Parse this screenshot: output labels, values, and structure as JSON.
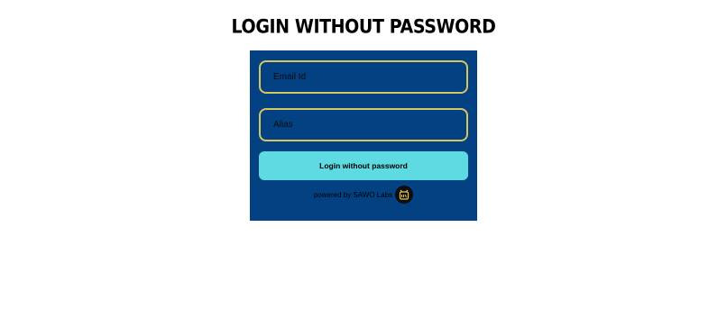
{
  "page": {
    "title": "LOGIN WITHOUT PASSWORD"
  },
  "form": {
    "email_placeholder": "Email Id",
    "email_value": "",
    "alias_placeholder": "Alias",
    "alias_value": "",
    "submit_label": "Login without password",
    "powered_by": "powered by SAWO Labs",
    "logo_icon": "sawo-labs-logo-icon"
  },
  "colors": {
    "card_background": "#034183",
    "field_border": "#d4c761",
    "button_background": "#5ddae2",
    "logo_background": "#0d0d0d",
    "logo_accent": "#e8c44a"
  }
}
